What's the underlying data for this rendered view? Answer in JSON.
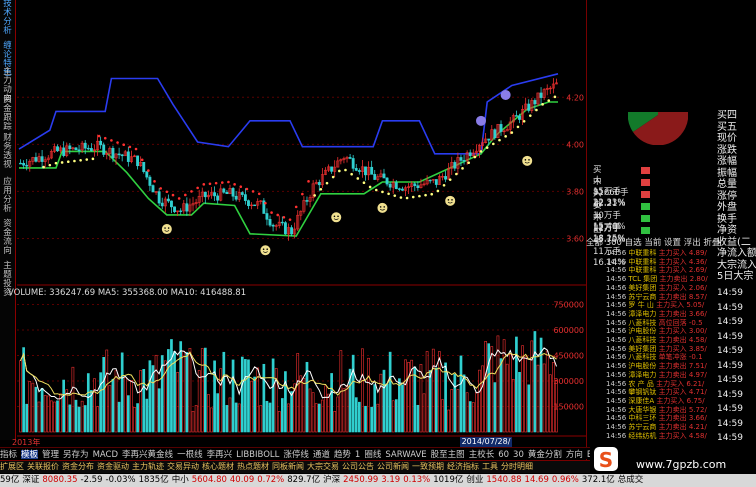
{
  "sidebar": {
    "items": [
      "技术分析",
      "缠论特色",
      "主力动向",
      "资金跟踪",
      "财务透视",
      "应用分析",
      "资金流向",
      "主题投资"
    ]
  },
  "volume_header": {
    "text": "VOLUME: 336247.69  MA5: 355368.00  MA10: 416488.81"
  },
  "price_axis": [
    "4.20",
    "4.00",
    "3.80",
    "3.60"
  ],
  "volume_axis": [
    "750000",
    "600000",
    "450000",
    "300000",
    "150000"
  ],
  "x_axis": {
    "year": "2013年",
    "labels": [
      "11",
      "12",
      "1",
      "2",
      "3",
      "4",
      "5",
      "6",
      "7",
      "8",
      "9"
    ],
    "date_box": "2014/07/28/一"
  },
  "order_book": {
    "sell": [
      {
        "side": "买",
        "size": "大",
        "bar": "15万手",
        "pct": "22.33%",
        "color": "#e04040"
      },
      {
        "side": "",
        "size": "中",
        "bar": "81660手",
        "pct": "12.21%",
        "color": "#e04040"
      },
      {
        "side": "入",
        "size": "小",
        "bar": "10万手",
        "pct": "15.46%",
        "color": "#e04040"
      }
    ],
    "buy": [
      {
        "side": "卖",
        "size": "大",
        "bar": "12万手",
        "pct": "18.15%",
        "color": "#30c040"
      },
      {
        "side": "",
        "size": "中",
        "bar": "11万手",
        "pct": "15.70%",
        "color": "#30c040"
      },
      {
        "side": "出",
        "size": "小",
        "bar": "11万手",
        "pct": "16.14%",
        "color": "#30c040"
      }
    ]
  },
  "tabs": "全部 300 自选 当前 设置 浮出 折叠",
  "trades": [
    {
      "t": "14:56",
      "name": "中联重科",
      "act": "主力买入",
      "v": "4.89/"
    },
    {
      "t": "14:56",
      "name": "中联重科",
      "act": "主力买入",
      "v": "4.36/"
    },
    {
      "t": "14:56",
      "name": "中联重科",
      "act": "主力买入",
      "v": "2.69/"
    },
    {
      "t": "14:56",
      "name": "TCL 集团",
      "act": "主力卖出",
      "v": "2.80/"
    },
    {
      "t": "14:56",
      "name": "美好集团",
      "act": "主力买入",
      "v": "2.06/"
    },
    {
      "t": "14:56",
      "name": "苏宁云商",
      "act": "主力卖出",
      "v": "8.57/"
    },
    {
      "t": "14:56",
      "name": "罗 牛 山",
      "act": "主力买入",
      "v": "5.05/"
    },
    {
      "t": "14:56",
      "name": "漳泽电力",
      "act": "主力卖出",
      "v": "3.66/"
    },
    {
      "t": "14:56",
      "name": "八菱科技",
      "act": "高位回落",
      "v": "-0.5"
    },
    {
      "t": "14:56",
      "name": "沪电股份",
      "act": "主力买入",
      "v": "3.00/"
    },
    {
      "t": "14:56",
      "name": "八菱科技",
      "act": "主力卖出",
      "v": "4.58/"
    },
    {
      "t": "14:56",
      "name": "美好集团",
      "act": "主力买入",
      "v": "3.85/"
    },
    {
      "t": "14:56",
      "name": "八菱科技",
      "act": "单笔冲涨",
      "v": "-0.1"
    },
    {
      "t": "14:56",
      "name": "沪电股份",
      "act": "主力卖出",
      "v": "7.51/"
    },
    {
      "t": "14:56",
      "name": "漳泽电力",
      "act": "主力卖出",
      "v": "4.97/"
    },
    {
      "t": "14:56",
      "name": "农 产 品",
      "act": "主力买入",
      "v": "6.21/"
    },
    {
      "t": "14:56",
      "name": "攀钢钒钛",
      "act": "主力买入",
      "v": "4.71/"
    },
    {
      "t": "14:56",
      "name": "深康佳A",
      "act": "主力买入",
      "v": "6.75/"
    },
    {
      "t": "14:56",
      "name": "大唐华银",
      "act": "主力卖出",
      "v": "5.72/"
    },
    {
      "t": "14:56",
      "name": "中科三环",
      "act": "主力卖出",
      "v": "3.66/"
    },
    {
      "t": "14:56",
      "name": "苏宁云商",
      "act": "主力卖出",
      "v": "4.21/"
    },
    {
      "t": "14:56",
      "name": "经纬纺机",
      "act": "主力买入",
      "v": "4.58/"
    }
  ],
  "right_col": {
    "labels": [
      "买四",
      "买五",
      "现价",
      "涨跌",
      "涨幅",
      "振幅",
      "总量",
      "涨停",
      "外盘",
      "换手",
      "净资",
      "收益(二",
      "净流入额",
      "大宗流入",
      "5日大宗"
    ],
    "times": [
      "14:59",
      "14:59",
      "14:59",
      "14:59",
      "14:59",
      "14:59",
      "14:59",
      "14:59",
      "14:59",
      "14:59",
      "14:59"
    ]
  },
  "bottom_tabs": [
    "指标",
    "模板",
    "管理",
    "另存为",
    "MACD",
    "李再兴黄金线",
    "一根线",
    "李再兴",
    "LIBBIBOLL",
    "涨停线",
    "通道",
    "趋势",
    "1",
    "圈线",
    "SARWAVE",
    "股至主图",
    "主校长",
    "60",
    "30",
    "黄金分割",
    "方向",
    "BOLL",
    "2",
    "放大"
  ],
  "bottom_tools": [
    "扩展区",
    "关联报价",
    "资金分布",
    "资金驱动",
    "主力轨迹",
    "交易异动",
    "核心题材",
    "热点题材",
    "同板新闻",
    "大宗交易",
    "公司公告",
    "公司新闻",
    "一致预期",
    "经济指标",
    "工具",
    "分时明细"
  ],
  "status": [
    {
      "t": "59亿",
      "c": ""
    },
    {
      "t": "深证",
      "c": ""
    },
    {
      "t": "8080.35",
      "c": "r"
    },
    {
      "t": "-2.59",
      "c": ""
    },
    {
      "t": "-0.03%",
      "c": ""
    },
    {
      "t": "1835亿",
      "c": ""
    },
    {
      "t": "中小",
      "c": ""
    },
    {
      "t": "5604.80",
      "c": "r"
    },
    {
      "t": "40.09",
      "c": "r"
    },
    {
      "t": "0.72%",
      "c": "r"
    },
    {
      "t": "829.7亿",
      "c": ""
    },
    {
      "t": "沪深",
      "c": ""
    },
    {
      "t": "2450.99",
      "c": "r"
    },
    {
      "t": "3.19",
      "c": "r"
    },
    {
      "t": "0.13%",
      "c": "r"
    },
    {
      "t": "1019亿",
      "c": ""
    },
    {
      "t": "创业",
      "c": ""
    },
    {
      "t": "1540.88",
      "c": "r"
    },
    {
      "t": "14.69",
      "c": "r"
    },
    {
      "t": "0.96%",
      "c": "r"
    },
    {
      "t": "372.1亿",
      "c": ""
    },
    {
      "t": "总成交",
      "c": ""
    }
  ],
  "watermark": "www.7gpzb.com",
  "chart_data": {
    "type": "candlestick",
    "price_ylim": [
      3.5,
      4.35
    ],
    "volume_ylim": [
      0,
      800000
    ],
    "price_ticks": [
      4.2,
      4.0,
      3.8,
      3.6
    ],
    "volume_ticks": [
      750000,
      600000,
      450000,
      300000,
      150000
    ],
    "volume": 336247.69,
    "ma5": 355368.0,
    "ma10": 416488.81
  }
}
